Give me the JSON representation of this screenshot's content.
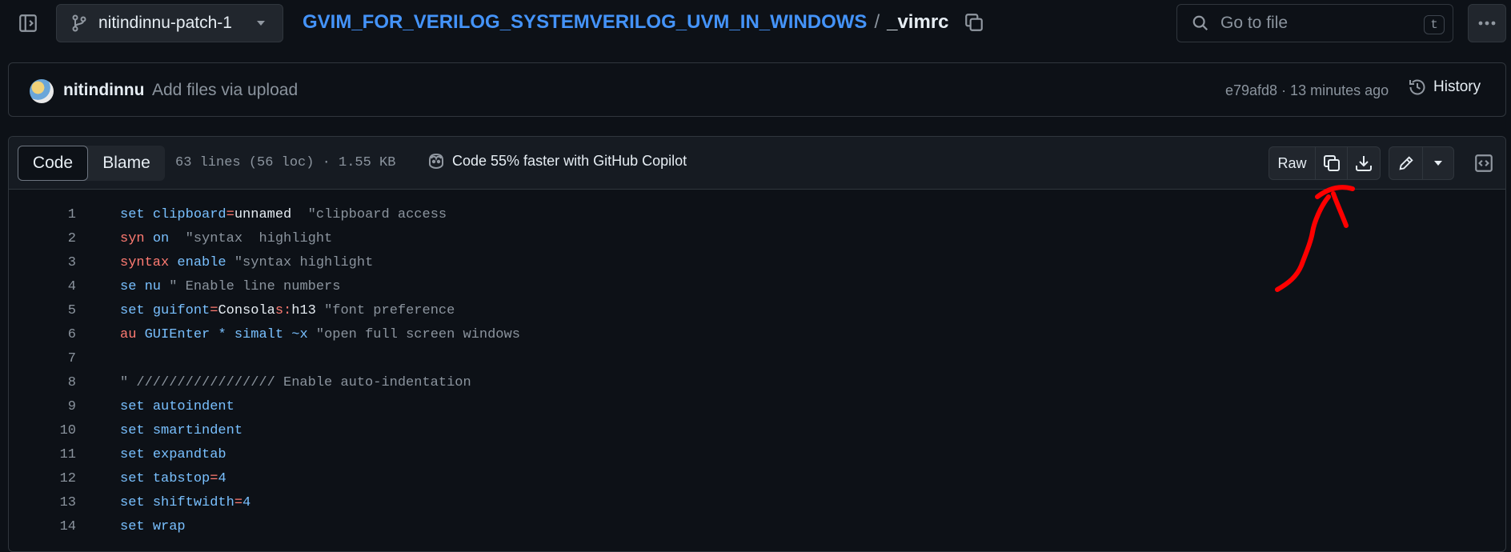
{
  "topbar": {
    "branch": "nitindinnu-patch-1",
    "repo": "GVIM_FOR_VERILOG_SYSTEMVERILOG_UVM_IN_WINDOWS",
    "separator": "/",
    "file": "_vimrc",
    "goto_placeholder": "Go to file",
    "goto_shortcut": "t"
  },
  "commit": {
    "author": "nitindinnu",
    "message": "Add files via upload",
    "meta": "e79afd8 · 13 minutes ago",
    "history_label": "History"
  },
  "file_header": {
    "tabs": [
      {
        "label": "Code",
        "active": true
      },
      {
        "label": "Blame",
        "active": false
      }
    ],
    "info": "63 lines (56 loc) · 1.55 KB",
    "copilot": "Code 55% faster with GitHub Copilot",
    "raw_label": "Raw"
  },
  "code_lines": [
    {
      "n": "1",
      "tokens": [
        [
          "kw",
          "set"
        ],
        [
          "pl",
          " "
        ],
        [
          "kw",
          "clipboard"
        ],
        [
          "red",
          "="
        ],
        [
          "pl",
          "unnamed  "
        ],
        [
          "cm",
          "\"clipboard access"
        ]
      ]
    },
    {
      "n": "2",
      "tokens": [
        [
          "red",
          "syn"
        ],
        [
          "pl",
          " "
        ],
        [
          "kw",
          "on"
        ],
        [
          "pl",
          "  "
        ],
        [
          "cm",
          "\"syntax  highlight"
        ]
      ]
    },
    {
      "n": "3",
      "tokens": [
        [
          "red",
          "syntax"
        ],
        [
          "pl",
          " "
        ],
        [
          "kw",
          "enable"
        ],
        [
          "pl",
          " "
        ],
        [
          "cm",
          "\"syntax highlight"
        ]
      ]
    },
    {
      "n": "4",
      "tokens": [
        [
          "kw",
          "se"
        ],
        [
          "pl",
          " "
        ],
        [
          "kw",
          "nu"
        ],
        [
          "pl",
          " "
        ],
        [
          "cm",
          "\" Enable line numbers"
        ]
      ]
    },
    {
      "n": "5",
      "tokens": [
        [
          "kw",
          "set"
        ],
        [
          "pl",
          " "
        ],
        [
          "kw",
          "guifont"
        ],
        [
          "red",
          "="
        ],
        [
          "pl",
          "Consola"
        ],
        [
          "red",
          "s:"
        ],
        [
          "pl",
          "h13 "
        ],
        [
          "cm",
          "\"font preference"
        ]
      ]
    },
    {
      "n": "6",
      "tokens": [
        [
          "red",
          "au"
        ],
        [
          "pl",
          " "
        ],
        [
          "kw",
          "GUIEnter"
        ],
        [
          "pl",
          " "
        ],
        [
          "kw",
          "*"
        ],
        [
          "pl",
          " "
        ],
        [
          "kw",
          "simalt"
        ],
        [
          "pl",
          " "
        ],
        [
          "kw",
          "~x"
        ],
        [
          "pl",
          " "
        ],
        [
          "cm",
          "\"open full screen windows"
        ]
      ]
    },
    {
      "n": "7",
      "tokens": []
    },
    {
      "n": "8",
      "tokens": [
        [
          "cm",
          "\" ///////////////// Enable auto-indentation"
        ]
      ]
    },
    {
      "n": "9",
      "tokens": [
        [
          "kw",
          "set"
        ],
        [
          "pl",
          " "
        ],
        [
          "kw",
          "autoindent"
        ]
      ]
    },
    {
      "n": "10",
      "tokens": [
        [
          "kw",
          "set"
        ],
        [
          "pl",
          " "
        ],
        [
          "kw",
          "smartindent"
        ]
      ]
    },
    {
      "n": "11",
      "tokens": [
        [
          "kw",
          "set"
        ],
        [
          "pl",
          " "
        ],
        [
          "kw",
          "expandtab"
        ]
      ]
    },
    {
      "n": "12",
      "tokens": [
        [
          "kw",
          "set"
        ],
        [
          "pl",
          " "
        ],
        [
          "kw",
          "tabstop"
        ],
        [
          "red",
          "="
        ],
        [
          "kw",
          "4"
        ]
      ]
    },
    {
      "n": "13",
      "tokens": [
        [
          "kw",
          "set"
        ],
        [
          "pl",
          " "
        ],
        [
          "kw",
          "shiftwidth"
        ],
        [
          "red",
          "="
        ],
        [
          "kw",
          "4"
        ]
      ]
    },
    {
      "n": "14",
      "tokens": [
        [
          "kw",
          "set"
        ],
        [
          "pl",
          " "
        ],
        [
          "kw",
          "wrap"
        ]
      ]
    }
  ],
  "colors": {
    "accent": "#4493f8",
    "keyword": "#79c0ff",
    "keyword_red": "#ff7b72",
    "comment": "#8b949e",
    "annotation": "#ff0000"
  }
}
